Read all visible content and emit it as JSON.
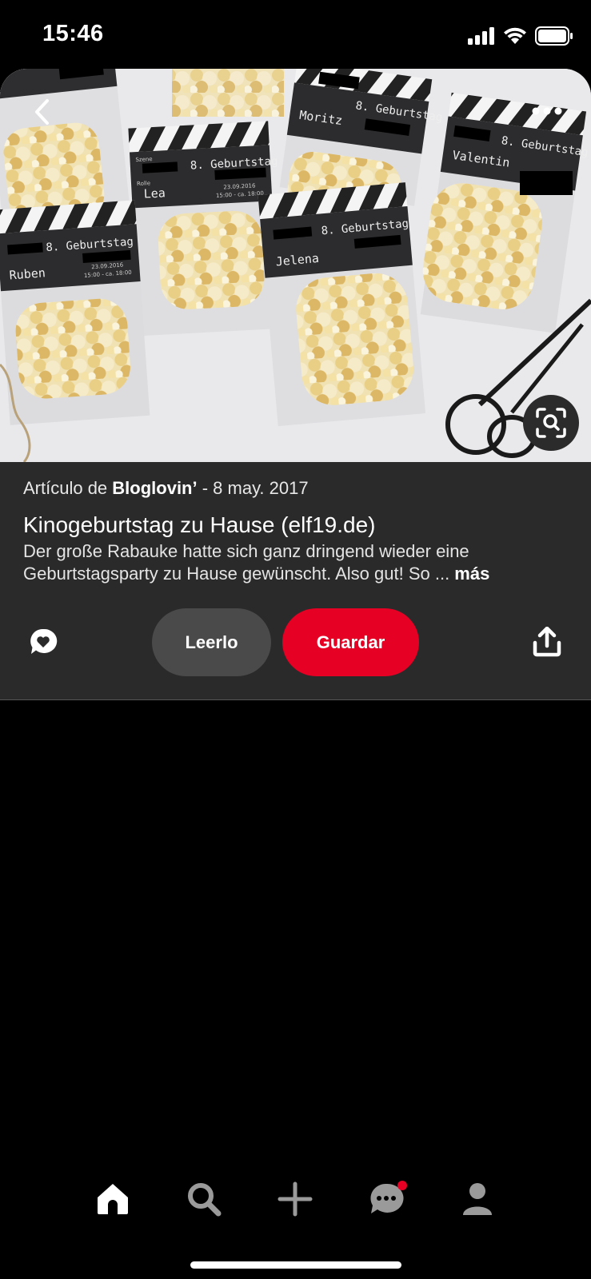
{
  "status_bar": {
    "time": "15:46"
  },
  "pin": {
    "image_labels": {
      "clapper_text": "8. Geburtstag",
      "names": [
        "Ruben",
        "Lea",
        "Jelena",
        "Moritz",
        "Valentin"
      ],
      "scene_label": "Szene",
      "role_label": "Rolle",
      "date_text": "23.09.2016",
      "time_text": "15:00 - ca. 18:00"
    },
    "meta_prefix": "Artículo de ",
    "source": "Bloglovin’",
    "meta_suffix": " - 8 may. 2017",
    "title": "Kinogeburtstag zu Hause (elf19.de)",
    "description_line1": "Der große Rabauke hatte sich ganz dringend wieder eine",
    "description_line2": "Geburtstagsparty zu Hause gewünscht. Also gut! So ... ",
    "more_label": "más"
  },
  "actions": {
    "read_label": "Leerlo",
    "save_label": "Guardar"
  },
  "colors": {
    "save": "#e60023",
    "panel": "#2a2a2a",
    "background": "#000000"
  },
  "nav": {
    "items": [
      "home-icon",
      "search-icon",
      "plus-icon",
      "chat-icon",
      "profile-icon"
    ],
    "notification_dot_on": "chat-icon"
  }
}
